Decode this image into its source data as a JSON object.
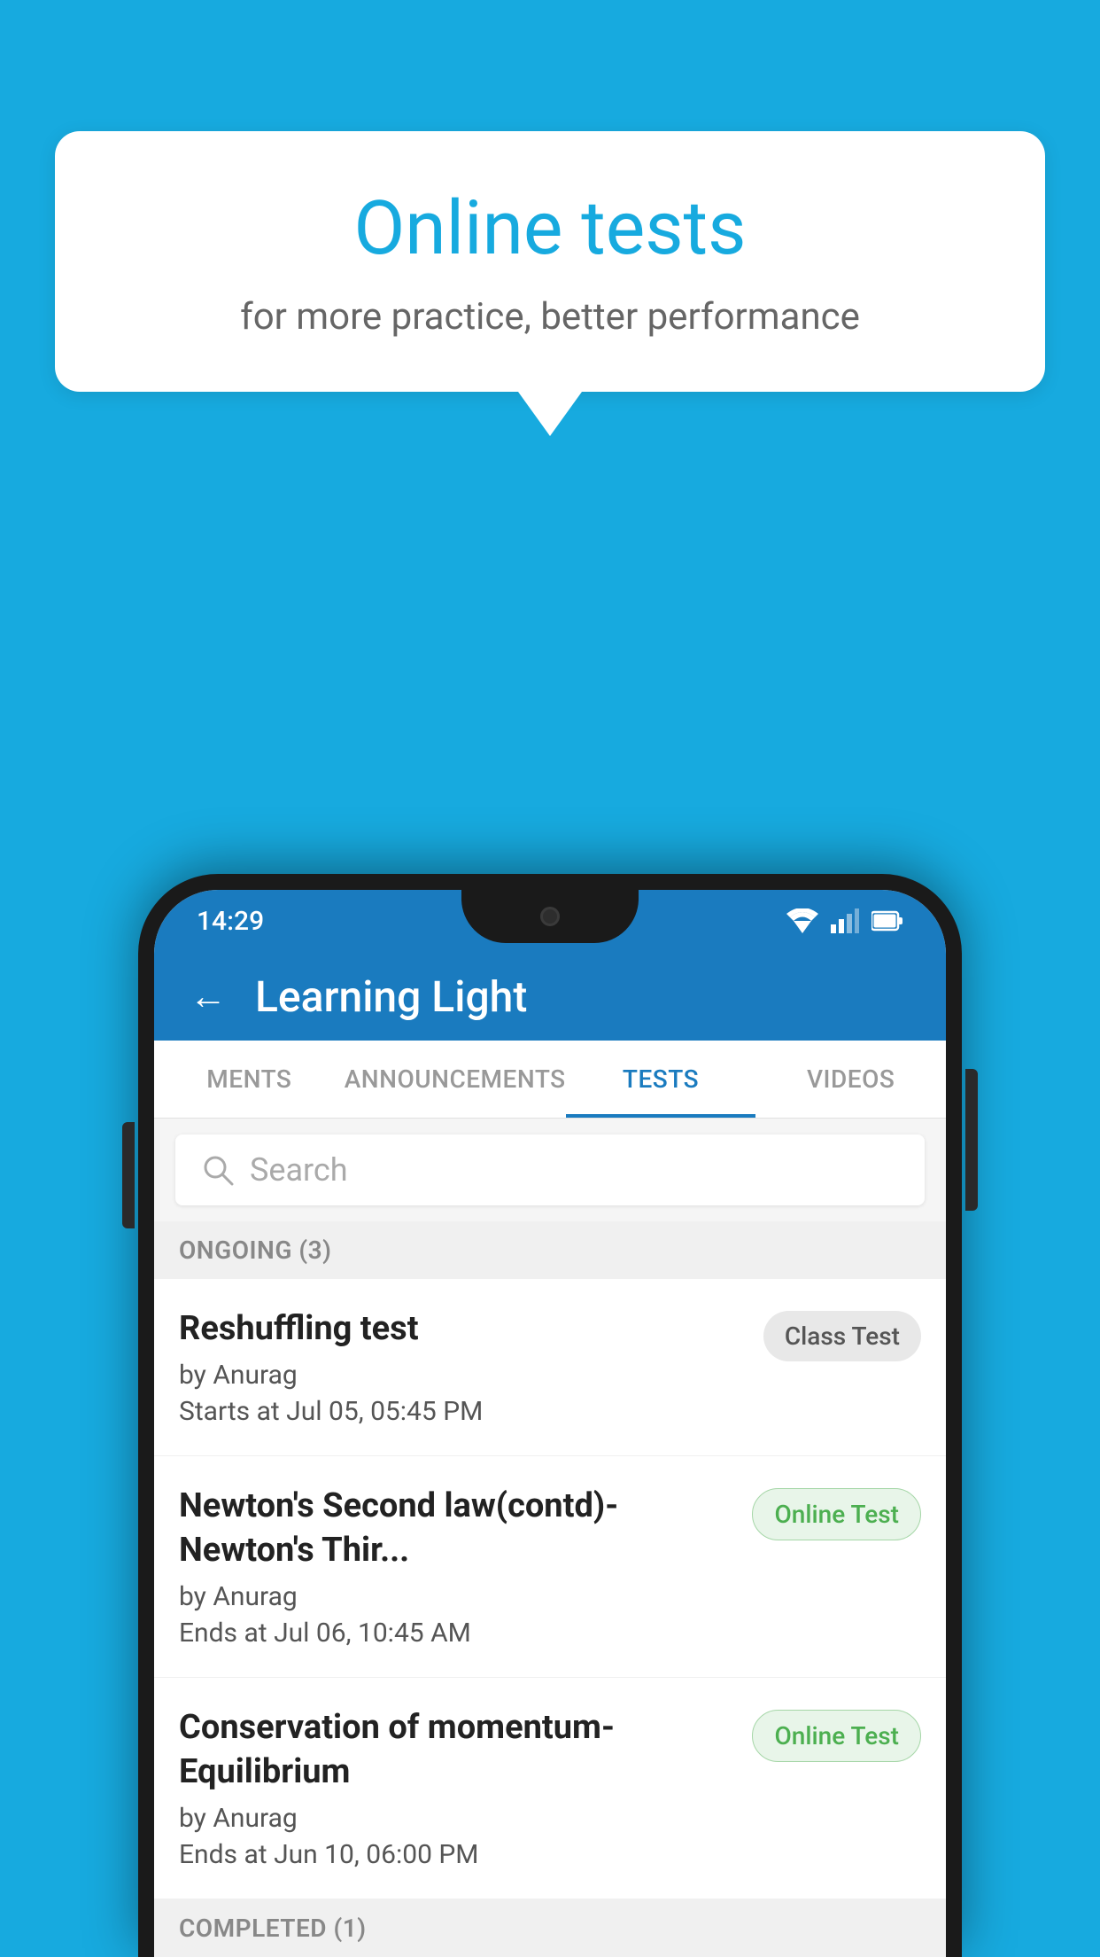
{
  "background_color": "#17AADF",
  "speech_bubble": {
    "title": "Online tests",
    "subtitle": "for more practice, better performance"
  },
  "phone": {
    "status_bar": {
      "time": "14:29"
    },
    "app_header": {
      "title": "Learning Light",
      "back_label": "←"
    },
    "tabs": [
      {
        "label": "MENTS",
        "active": false
      },
      {
        "label": "ANNOUNCEMENTS",
        "active": false
      },
      {
        "label": "TESTS",
        "active": true
      },
      {
        "label": "VIDEOS",
        "active": false
      }
    ],
    "search": {
      "placeholder": "Search"
    },
    "ongoing_section": {
      "label": "ONGOING (3)"
    },
    "tests": [
      {
        "name": "Reshuffling test",
        "author": "by Anurag",
        "time_label": "Starts at",
        "time": "Jul 05, 05:45 PM",
        "badge": "Class Test",
        "badge_type": "class"
      },
      {
        "name": "Newton's Second law(contd)-Newton's Thir...",
        "author": "by Anurag",
        "time_label": "Ends at",
        "time": "Jul 06, 10:45 AM",
        "badge": "Online Test",
        "badge_type": "online"
      },
      {
        "name": "Conservation of momentum-Equilibrium",
        "author": "by Anurag",
        "time_label": "Ends at",
        "time": "Jun 10, 06:00 PM",
        "badge": "Online Test",
        "badge_type": "online"
      }
    ],
    "completed_section": {
      "label": "COMPLETED (1)"
    }
  }
}
